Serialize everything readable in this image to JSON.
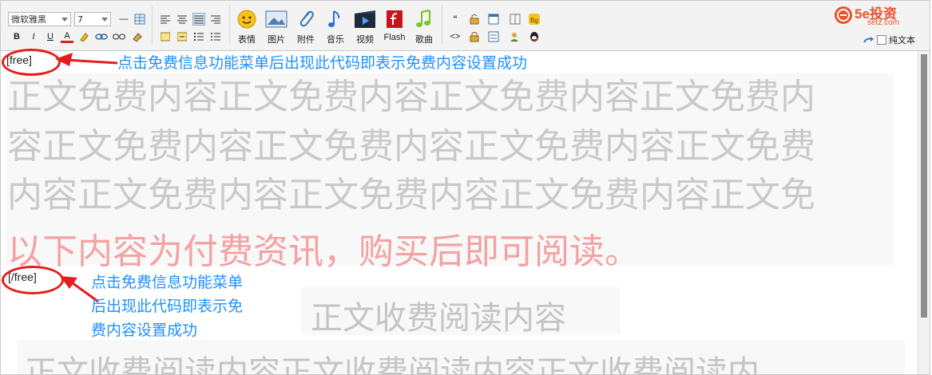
{
  "toolbar": {
    "font_family": "微软雅黑",
    "font_size": "7",
    "row1_small": [
      "—"
    ],
    "row2_small": [
      "B",
      "I",
      "U",
      "A"
    ],
    "quote_glyph": "“",
    "code_glyph": "<>",
    "buttons": [
      {
        "label": "表情",
        "icon": "emoji-icon"
      },
      {
        "label": "图片",
        "icon": "image-icon"
      },
      {
        "label": "附件",
        "icon": "attachment-icon"
      },
      {
        "label": "音乐",
        "icon": "music-note-icon"
      },
      {
        "label": "视频",
        "icon": "video-icon"
      },
      {
        "label": "Flash",
        "icon": "flash-icon"
      },
      {
        "label": "歌曲",
        "icon": "song-icon"
      }
    ],
    "plain_text_label": "纯文本",
    "logo_main": "5e投资",
    "logo_sub": "setz.com"
  },
  "content": {
    "free_open_tag": "[free]",
    "free_close_tag": "[/free]",
    "note_top": "点击免费信息功能菜单后出现此代码即表示免费内容设置成功",
    "note_bottom_lines": [
      "点击免费信息功能菜单",
      "后出现此代码即表示免",
      "费内容设置成功"
    ],
    "free_text_lines": [
      "正文免费内容正文免费内容正文免费内容正文免费内",
      "容正文免费内容正文免费内容正文免费内容正文免费",
      "内容正文免费内容正文免费内容正文免费内容正文免"
    ],
    "paid_notice": "以下内容为付费资讯，购买后即可阅读。",
    "paid_title": "正文收费阅读内容",
    "paid_body_partial": "正文收费阅读内容正文收费阅读内容正文收费阅读内"
  },
  "colors": {
    "annotation_red": "#e51c1c",
    "annotation_blue": "#1e90ff",
    "ghost_text": "#c9c9c9",
    "paid_notice": "#f3a2a2"
  }
}
